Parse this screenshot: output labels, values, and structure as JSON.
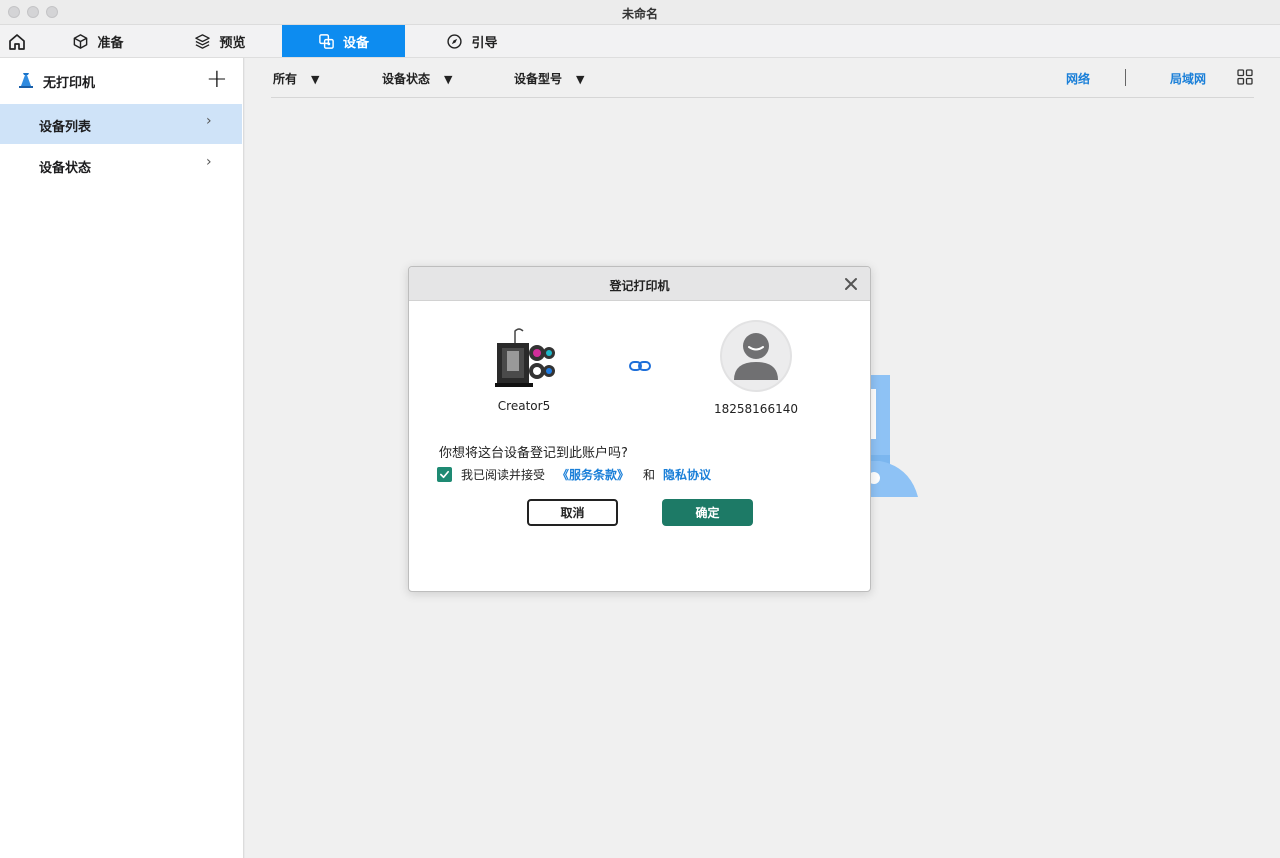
{
  "window": {
    "title": "未命名"
  },
  "tabs": [
    {
      "label": "准备",
      "icon": "cube-icon"
    },
    {
      "label": "预览",
      "icon": "layers-icon"
    },
    {
      "label": "设备",
      "icon": "device-icon",
      "active": true
    },
    {
      "label": "引导",
      "icon": "compass-icon"
    }
  ],
  "sidebar": {
    "printer_status": "无打印机",
    "items": [
      {
        "label": "设备列表",
        "active": true
      },
      {
        "label": "设备状态",
        "active": false
      }
    ]
  },
  "filters": {
    "all": "所有",
    "status": "设备状态",
    "model": "设备型号",
    "network": "网络",
    "lan": "局域网"
  },
  "dialog": {
    "title": "登记打印机",
    "printer_name": "Creator5",
    "account": "18258166140",
    "question": "你想将这台设备登记到此账户吗?",
    "agree_text": "我已阅读并接受",
    "terms_link": "《服务条款》",
    "and_text": "和",
    "privacy_link": "隐私协议",
    "cancel_label": "取消",
    "ok_label": "确定",
    "checked": true
  },
  "colors": {
    "accent": "#0d8cf0",
    "confirm": "#1d7a66",
    "link": "#1a7fd8",
    "sidebar_active": "#cfe3f8"
  }
}
